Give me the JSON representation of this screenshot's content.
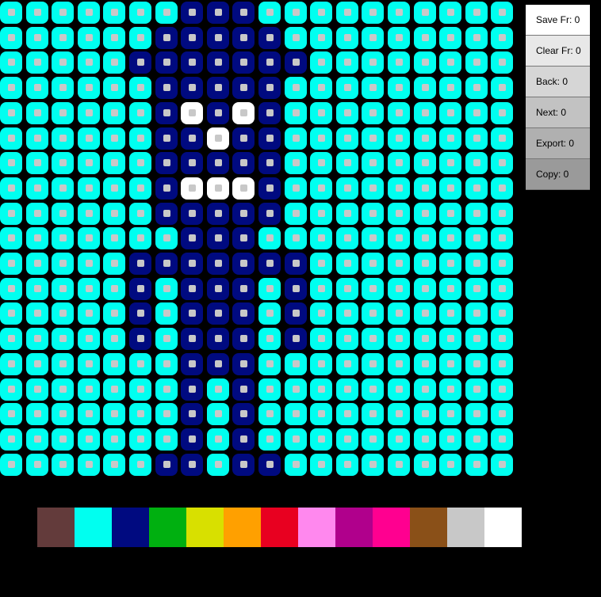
{
  "sidebar": {
    "buttons": [
      {
        "label": "Save Fr: 0",
        "color": "#ffffff"
      },
      {
        "label": "Clear Fr: 0",
        "color": "#e8e8e8"
      },
      {
        "label": "Back: 0",
        "color": "#d6d6d6"
      },
      {
        "label": "Next: 0",
        "color": "#c2c2c2"
      },
      {
        "label": "Export: 0",
        "color": "#b0b0b0"
      },
      {
        "label": "Copy: 0",
        "color": "#9a9a9a"
      }
    ]
  },
  "palette": [
    "#633b3b",
    "#00fff0",
    "#000a80",
    "#00b010",
    "#d8e000",
    "#ffa000",
    "#e80020",
    "#ff88ee",
    "#b0008c",
    "#ff0090",
    "#8a5018",
    "#c8c8c8",
    "#ffffff"
  ],
  "grid": {
    "colors": {
      "C": "#00fff0",
      "N": "#000a80",
      "W": "#ffffff"
    },
    "dot_colors": {
      "C": "#c8c8c8",
      "N": "#c8c8c8",
      "W": "#c8c8c8"
    },
    "rows": [
      "CCCCCCCNNNCCCCCCCCCC",
      "CCCCCCNNNNNCCCCCCCCC",
      "CCCCCNNNNNNNCCCCCCCC",
      "CCCCCCNNNNNCCCCCCCCC",
      "CCCCCCNWNWNCCCCCCCCC",
      "CCCCCCNNWNNCCCCCCCCC",
      "CCCCCCNNNNNCCCCCCCCC",
      "CCCCCCNWWWNCCCCCCCCC",
      "CCCCCCNNNNNCCCCCCCCC",
      "CCCCCCCNNNCCCCCCCCCC",
      "CCCCCNNNNNNNCCCCCCCC",
      "CCCCCNCNNNCNCCCCCCCC",
      "CCCCCNCNNNCNCCCCCCCC",
      "CCCCCNCNNNCNCCCCCCCC",
      "CCCCCCCNNNCCCCCCCCCC",
      "CCCCCCCNCNCCCCCCCCCC",
      "CCCCCCCNCNCCCCCCCCCC",
      "CCCCCCCNCNCCCCCCCCCC",
      "CCCCCCNNCNNCCCCCCCCC"
    ]
  }
}
